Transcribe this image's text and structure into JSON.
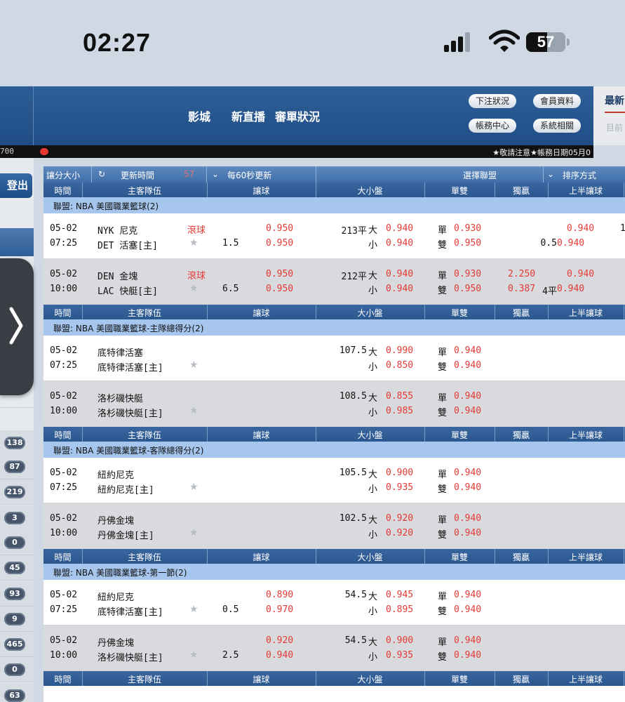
{
  "status_bar": {
    "time": "02:27",
    "battery": "57",
    "icons": [
      "signal-icon",
      "wifi-icon",
      "battery-icon"
    ]
  },
  "header": {
    "nav": [
      "影城",
      "新直播",
      "審單狀況"
    ],
    "buttons": [
      "下注狀況",
      "會員資料",
      "帳務中心",
      "系統相關"
    ],
    "right_title": "最新",
    "right_sub": "目前"
  },
  "info_bar": {
    "left": "700",
    "notice": "★敬請注意★帳務日期05月0"
  },
  "left_column": {
    "logout": "登出",
    "badges": [
      "138",
      "87",
      "219",
      "3",
      "0",
      "45",
      "93",
      "9",
      "465",
      "0",
      "63"
    ]
  },
  "toolbar": {
    "handicap": "讓分大小",
    "refresh_time": "更新時間",
    "countdown": "57",
    "auto_refresh": "每60秒更新",
    "select_league": "選擇聯盟",
    "sort": "排序方式"
  },
  "columns": [
    "時間",
    "主客隊伍",
    "讓球",
    "大小盤",
    "單雙",
    "獨贏",
    "上半讓球"
  ],
  "sections": [
    {
      "league": "聯盟: NBA 美國職業籃球(2)",
      "matches": [
        {
          "date": "05-02",
          "time": "07:25",
          "home": "NYK 尼克",
          "away": "DET 活塞[主]",
          "live": "滾球",
          "hcp": "1.5",
          "hcp_top": "0.950",
          "hcp_bot": "0.950",
          "ou_line": "213平",
          "ou_top_label": "大",
          "ou_top": "0.940",
          "ou_bot_label": "小",
          "ou_bot": "0.940",
          "odd_label": "單",
          "odd": "0.930",
          "even_label": "雙",
          "even": "0.950",
          "ml_top": "",
          "ml_bot": "",
          "h1_line": "0.5",
          "h1_top": "0.940",
          "h1_bot": "0.940",
          "extra": "1"
        },
        {
          "date": "05-02",
          "time": "10:00",
          "home": "DEN 金塊",
          "away": "LAC 快艇[主]",
          "live": "滾球",
          "hcp": "6.5",
          "hcp_top": "0.950",
          "hcp_bot": "0.950",
          "ou_line": "212平",
          "ou_top_label": "大",
          "ou_top": "0.940",
          "ou_bot_label": "小",
          "ou_bot": "0.940",
          "odd_label": "單",
          "odd": "0.930",
          "even_label": "雙",
          "even": "0.950",
          "ml_top": "2.250",
          "ml_bot": "0.387",
          "h1_line": "4平",
          "h1_top": "0.940",
          "h1_bot": "0.940",
          "extra": ""
        }
      ]
    },
    {
      "league": "聯盟: NBA 美國職業籃球-主隊總得分(2)",
      "matches": [
        {
          "date": "05-02",
          "time": "07:25",
          "home": "底特律活塞",
          "away": "底特律活塞[主]",
          "live": "",
          "hcp": "",
          "hcp_top": "",
          "hcp_bot": "",
          "ou_line": "107.5",
          "ou_top_label": "大",
          "ou_top": "0.990",
          "ou_bot_label": "小",
          "ou_bot": "0.850",
          "odd_label": "單",
          "odd": "0.940",
          "even_label": "雙",
          "even": "0.940",
          "ml_top": "",
          "ml_bot": "",
          "h1_line": "",
          "h1_top": "",
          "h1_bot": "",
          "extra": ""
        },
        {
          "date": "05-02",
          "time": "10:00",
          "home": "洛杉磯快艇",
          "away": "洛杉磯快艇[主]",
          "live": "",
          "hcp": "",
          "hcp_top": "",
          "hcp_bot": "",
          "ou_line": "108.5",
          "ou_top_label": "大",
          "ou_top": "0.855",
          "ou_bot_label": "小",
          "ou_bot": "0.985",
          "odd_label": "單",
          "odd": "0.940",
          "even_label": "雙",
          "even": "0.940",
          "ml_top": "",
          "ml_bot": "",
          "h1_line": "",
          "h1_top": "",
          "h1_bot": "",
          "extra": ""
        }
      ]
    },
    {
      "league": "聯盟: NBA 美國職業籃球-客隊總得分(2)",
      "matches": [
        {
          "date": "05-02",
          "time": "07:25",
          "home": "紐約尼克",
          "away": "紐約尼克[主]",
          "live": "",
          "hcp": "",
          "hcp_top": "",
          "hcp_bot": "",
          "ou_line": "105.5",
          "ou_top_label": "大",
          "ou_top": "0.900",
          "ou_bot_label": "小",
          "ou_bot": "0.935",
          "odd_label": "單",
          "odd": "0.940",
          "even_label": "雙",
          "even": "0.940",
          "ml_top": "",
          "ml_bot": "",
          "h1_line": "",
          "h1_top": "",
          "h1_bot": "",
          "extra": ""
        },
        {
          "date": "05-02",
          "time": "10:00",
          "home": "丹佛金塊",
          "away": "丹佛金塊[主]",
          "live": "",
          "hcp": "",
          "hcp_top": "",
          "hcp_bot": "",
          "ou_line": "102.5",
          "ou_top_label": "大",
          "ou_top": "0.920",
          "ou_bot_label": "小",
          "ou_bot": "0.920",
          "odd_label": "單",
          "odd": "0.940",
          "even_label": "雙",
          "even": "0.940",
          "ml_top": "",
          "ml_bot": "",
          "h1_line": "",
          "h1_top": "",
          "h1_bot": "",
          "extra": ""
        }
      ]
    },
    {
      "league": "聯盟: NBA 美國職業籃球-第一節(2)",
      "matches": [
        {
          "date": "05-02",
          "time": "07:25",
          "home": "紐約尼克",
          "away": "底特律活塞[主]",
          "live": "",
          "hcp": "0.5",
          "hcp_top": "0.890",
          "hcp_bot": "0.970",
          "ou_line": "54.5",
          "ou_top_label": "大",
          "ou_top": "0.945",
          "ou_bot_label": "小",
          "ou_bot": "0.895",
          "odd_label": "單",
          "odd": "0.940",
          "even_label": "雙",
          "even": "0.940",
          "ml_top": "",
          "ml_bot": "",
          "h1_line": "",
          "h1_top": "",
          "h1_bot": "",
          "extra": ""
        },
        {
          "date": "05-02",
          "time": "10:00",
          "home": "丹佛金塊",
          "away": "洛杉磯快艇[主]",
          "live": "",
          "hcp": "2.5",
          "hcp_top": "0.920",
          "hcp_bot": "0.940",
          "ou_line": "54.5",
          "ou_top_label": "大",
          "ou_top": "0.900",
          "ou_bot_label": "小",
          "ou_bot": "0.935",
          "odd_label": "單",
          "odd": "0.940",
          "even_label": "雙",
          "even": "0.940",
          "ml_top": "",
          "ml_bot": "",
          "h1_line": "",
          "h1_top": "",
          "h1_bot": "",
          "extra": ""
        }
      ]
    },
    {
      "league": "",
      "matches": []
    }
  ]
}
